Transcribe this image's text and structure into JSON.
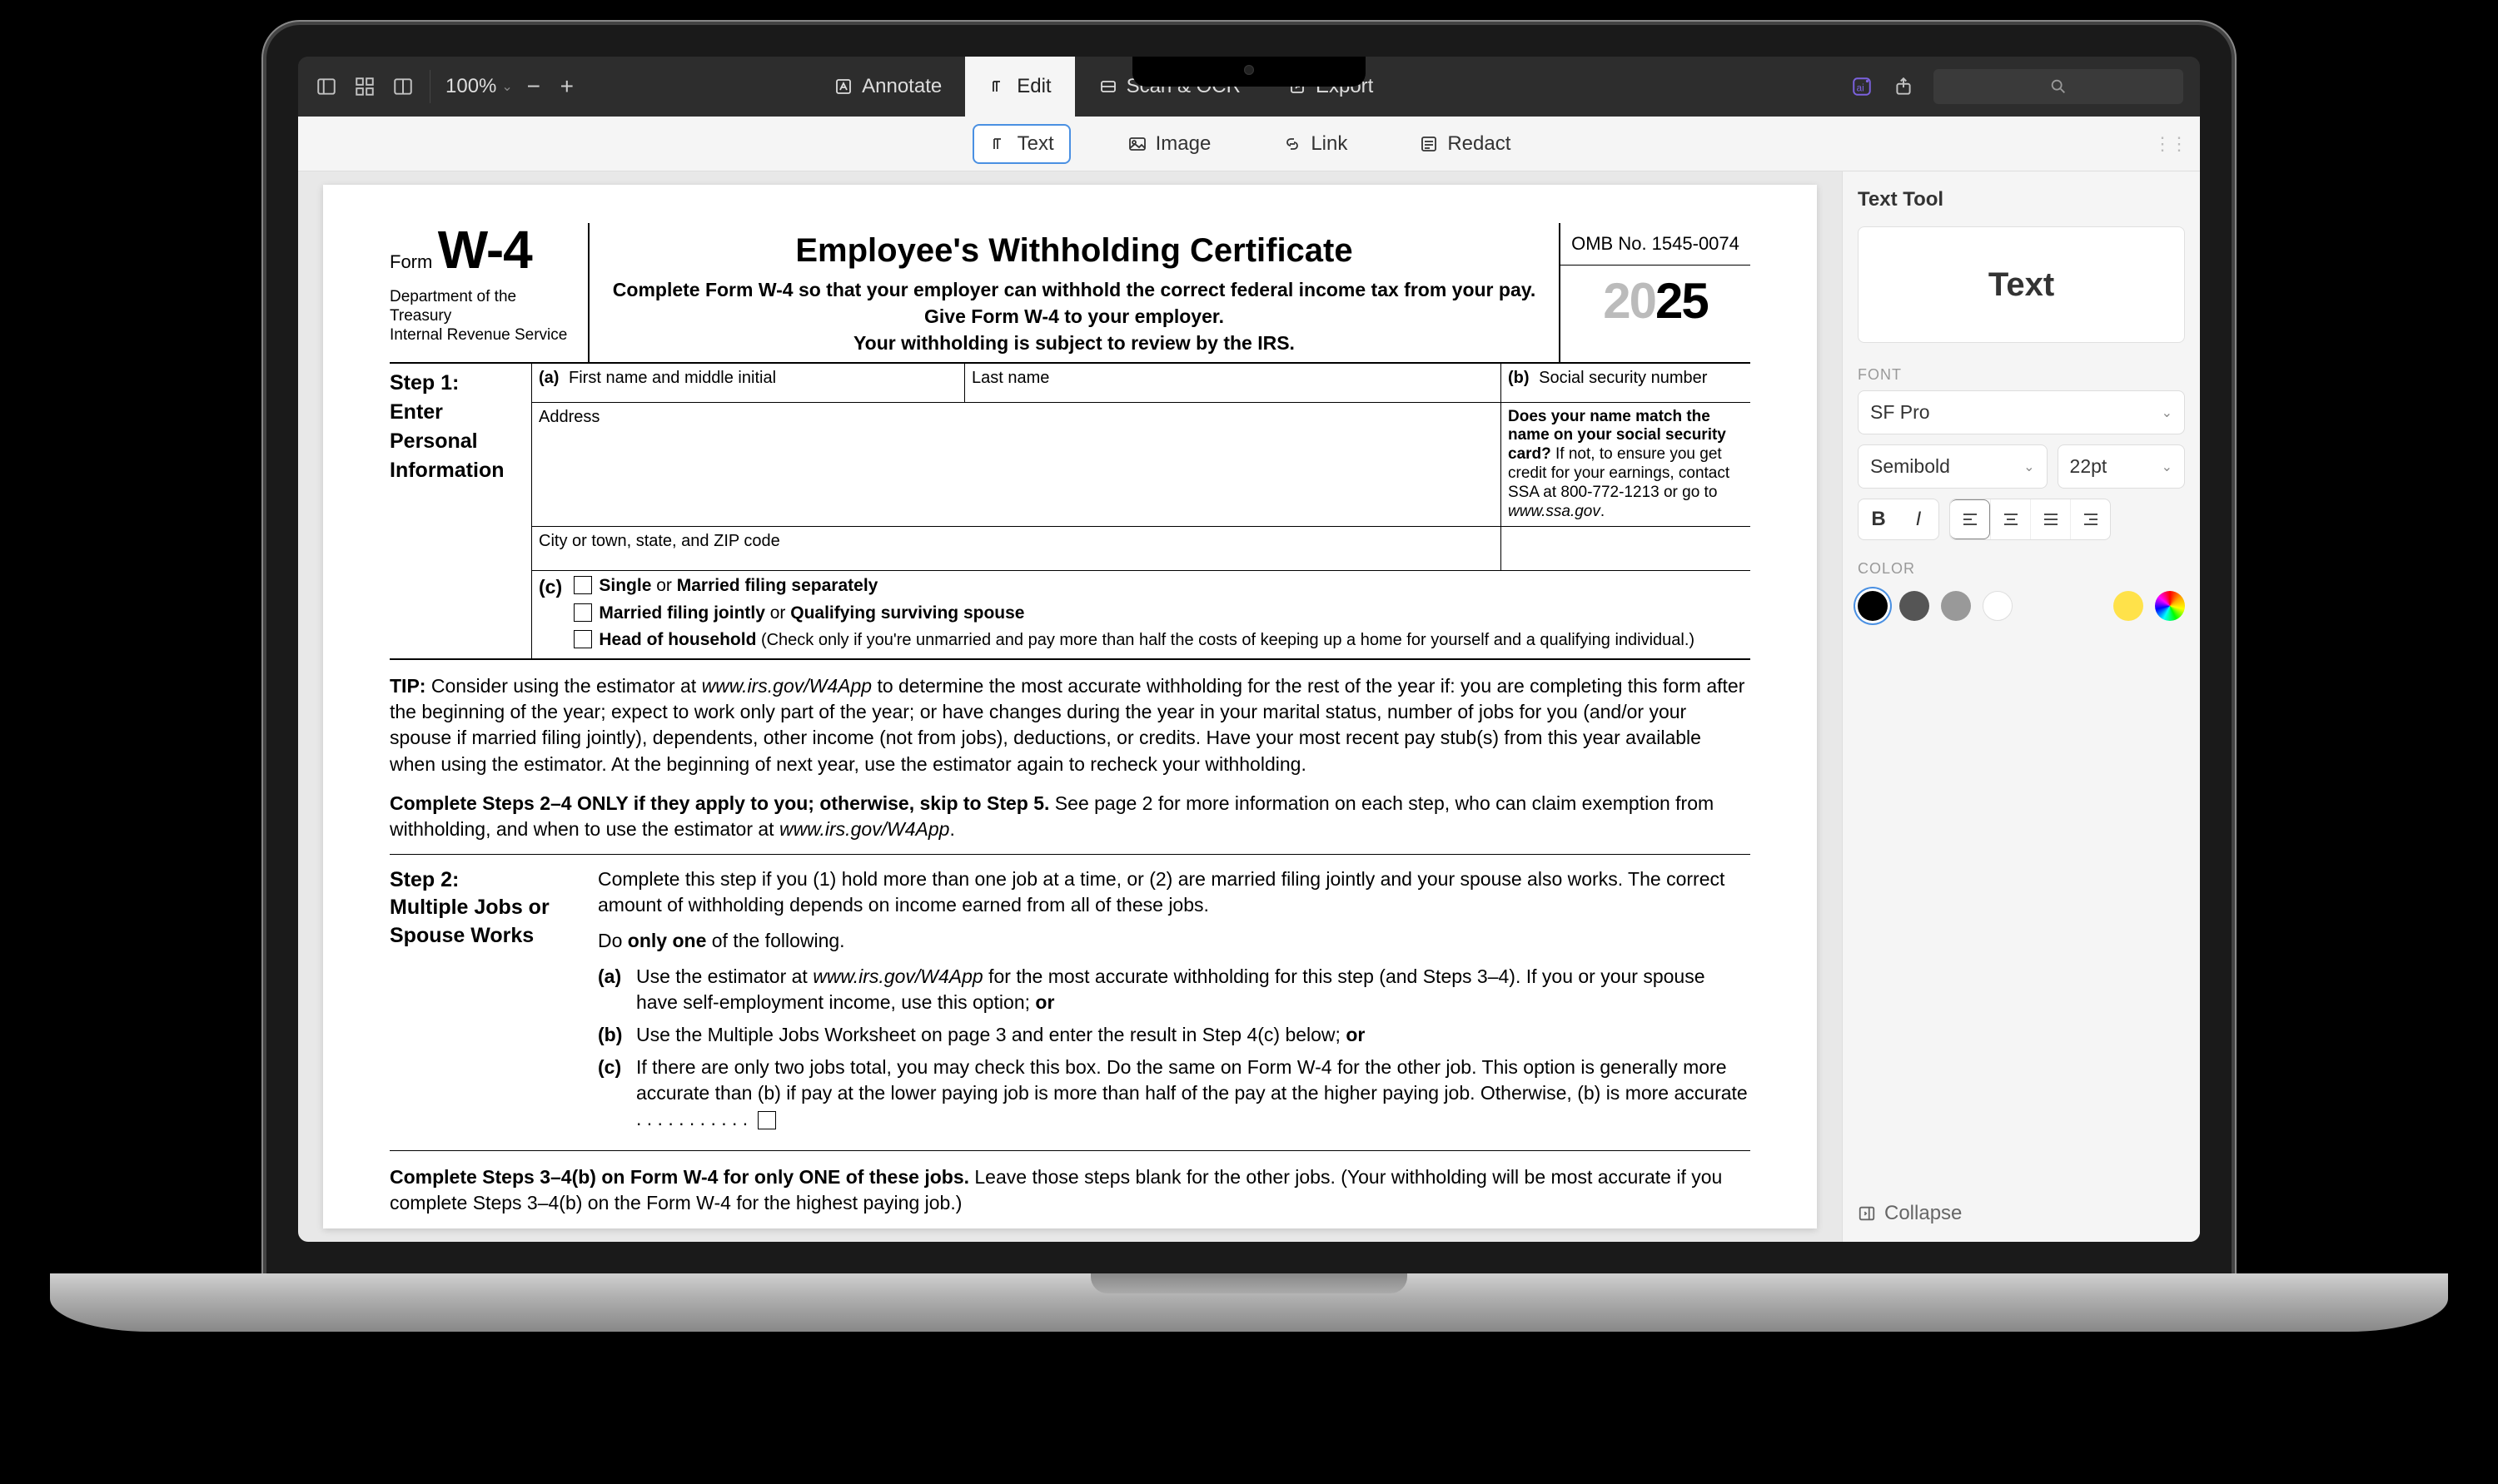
{
  "toolbar": {
    "zoom": "100%",
    "tabs": {
      "annotate": "Annotate",
      "edit": "Edit",
      "scan": "Scan & OCR",
      "export": "Export"
    }
  },
  "subtoolbar": {
    "text": "Text",
    "image": "Image",
    "link": "Link",
    "redact": "Redact"
  },
  "sidebar": {
    "title": "Text Tool",
    "preview": "Text",
    "font_label": "FONT",
    "font_family": "SF Pro",
    "font_weight": "Semibold",
    "font_size": "22pt",
    "color_label": "COLOR",
    "collapse": "Collapse",
    "colors": [
      "#000000",
      "#555555",
      "#999999",
      "#ffffff",
      "#ffe24a"
    ]
  },
  "doc": {
    "form_prefix": "Form",
    "form_code": "W-4",
    "dept1": "Department of the Treasury",
    "dept2": "Internal Revenue Service",
    "title": "Employee's Withholding Certificate",
    "subtitle1": "Complete Form W-4 so that your employer can withhold the correct federal income tax from your pay.",
    "subtitle2": "Give Form W-4 to your employer.",
    "subtitle3": "Your withholding is subject to review by the IRS.",
    "omb": "OMB No. 1545-0074",
    "year_gray": "20",
    "year_bold": "25",
    "step1": {
      "heading": "Step 1:",
      "sub": "Enter Personal Information",
      "a_label": "(a)",
      "a_first": "First name and middle initial",
      "a_last": "Last name",
      "b_label": "(b)",
      "b_text": "Social security number",
      "address": "Address",
      "city": "City or town, state, and ZIP code",
      "ssn_note_bold": "Does your name match the name on your social security card?",
      "ssn_note_rest": " If not, to ensure you get credit for your earnings, contact SSA at 800-772-1213 or go to ",
      "ssn_note_url": "www.ssa.gov",
      "c_label": "(c)",
      "c_opt1a": "Single",
      "c_opt1_or": " or ",
      "c_opt1b": "Married filing separately",
      "c_opt2a": "Married filing jointly",
      "c_opt2_or": " or ",
      "c_opt2b": "Qualifying surviving spouse",
      "c_opt3a": "Head of household",
      "c_opt3b": " (Check only if you're unmarried and pay more than half the costs of keeping up a home for yourself and a qualifying individual.)"
    },
    "tip_label": "TIP:",
    "tip_text_a": " Consider using the estimator at ",
    "tip_url": "www.irs.gov/W4App",
    "tip_text_b": " to determine the most accurate withholding for the rest of the year if: you are completing this form after the beginning of the year; expect to work only part of the year; or have changes during the year in your marital status, number of jobs for you (and/or your spouse if married filing jointly), dependents, other income (not from jobs), deductions, or credits. Have your most recent pay stub(s) from this year available when using the estimator. At the beginning of next year, use the estimator again to recheck your withholding.",
    "complete24_bold": "Complete Steps 2–4 ONLY if they apply to you; otherwise, skip to Step 5.",
    "complete24_rest": " See page 2 for more information on each step, who can claim exemption from withholding, and when to use the estimator at ",
    "complete24_url": "www.irs.gov/W4App",
    "step2": {
      "heading": "Step 2:",
      "sub": "Multiple Jobs or Spouse Works",
      "intro": "Complete this step if you (1) hold more than one job at a time, or (2) are married filing jointly and your spouse also works. The correct amount of withholding depends on income earned from all of these jobs.",
      "do_a": "Do ",
      "do_b": "only one",
      "do_c": " of the following.",
      "a_label": "(a)",
      "a_text_1": "Use the estimator at ",
      "a_url": "www.irs.gov/W4App",
      "a_text_2": " for the most accurate withholding for this step (and Steps 3–4). If you or your spouse have self-employment income, use this option; ",
      "a_or": "or",
      "b_label": "(b)",
      "b_text": "Use the Multiple Jobs Worksheet on page 3 and enter the result in Step 4(c) below; ",
      "b_or": "or",
      "c_label": "(c)",
      "c_text": "If there are only two jobs total, you may check this box. Do the same on Form W-4 for the other job. This option is generally more accurate than (b) if pay at the lower paying job is more than half of the pay at the higher paying job. Otherwise, (b) is more accurate",
      "c_dots": "  .    .    .    .    .    .    .    .    .    .    ."
    },
    "complete34_bold": "Complete Steps 3–4(b) on Form W-4 for only ONE of these jobs.",
    "complete34_rest": " Leave those steps blank for the other jobs. (Your withholding will be most accurate if you complete Steps 3–4(b) on the Form W-4 for the highest paying job.)"
  }
}
